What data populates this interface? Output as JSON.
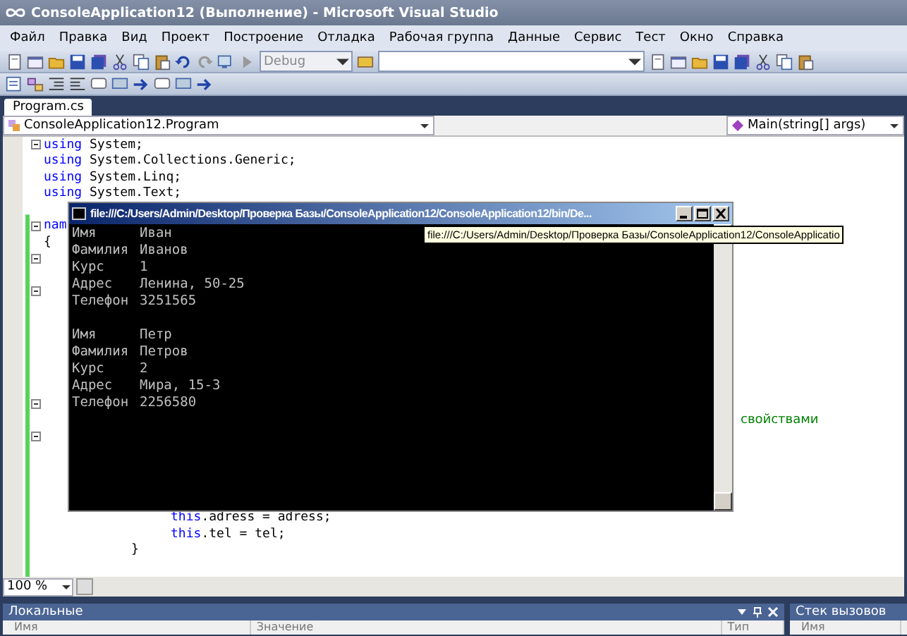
{
  "window": {
    "title": "ConsoleApplication12 (Выполнение) - Microsoft Visual Studio"
  },
  "menu": [
    "Файл",
    "Правка",
    "Вид",
    "Проект",
    "Построение",
    "Отладка",
    "Рабочая группа",
    "Данные",
    "Сервис",
    "Тест",
    "Окно",
    "Справка"
  ],
  "toolbar": {
    "configuration": {
      "value": "Debug",
      "disabled": true
    }
  },
  "document_tabs": [
    {
      "label": "Program.cs",
      "selected": true
    }
  ],
  "nav_bar": {
    "type": "ConsoleApplication12.Program",
    "member": "Main(string[] args)"
  },
  "code_lines": [
    {
      "fold": true,
      "segments": [
        {
          "kind": "keyword",
          "text": "using"
        },
        {
          "kind": "plain",
          "text": " System;"
        }
      ]
    },
    {
      "fold": false,
      "segments": [
        {
          "kind": "keyword",
          "text": "using"
        },
        {
          "kind": "plain",
          "text": " System.Collections.Generic;"
        }
      ]
    },
    {
      "fold": false,
      "segments": [
        {
          "kind": "keyword",
          "text": "using"
        },
        {
          "kind": "plain",
          "text": " System.Linq;"
        }
      ]
    },
    {
      "fold": false,
      "segments": [
        {
          "kind": "keyword",
          "text": "using"
        },
        {
          "kind": "plain",
          "text": " System.Text;"
        }
      ]
    },
    {
      "fold": false
    },
    {
      "fold": true,
      "segments": [
        {
          "kind": "keyword",
          "text": "nam"
        }
      ]
    },
    {
      "fold": false,
      "segments": [
        {
          "kind": "plain",
          "text": "{"
        }
      ]
    },
    {
      "fold": true
    },
    {
      "fold": false
    },
    {
      "fold": true
    },
    {
      "fold": false
    },
    {
      "fold": false
    },
    {
      "fold": false
    },
    {
      "fold": false
    },
    {
      "fold": false
    },
    {
      "fold": false
    },
    {
      "fold": true
    },
    {
      "fold": false,
      "segments": [
        {
          "kind": "comment_tail",
          "text": "свойствами"
        }
      ]
    },
    {
      "fold": true
    },
    {
      "fold": false
    },
    {
      "fold": false
    },
    {
      "fold": false
    },
    {
      "fold": false
    },
    {
      "fold": false,
      "segments": [
        {
          "kind": "indent3"
        },
        {
          "kind": "keyword",
          "text": "this"
        },
        {
          "kind": "plain",
          "text": ".adress = adress;"
        }
      ]
    },
    {
      "fold": false,
      "segments": [
        {
          "kind": "indent3"
        },
        {
          "kind": "keyword",
          "text": "this"
        },
        {
          "kind": "plain",
          "text": ".tel = tel;"
        }
      ]
    },
    {
      "fold": false,
      "segments": [
        {
          "kind": "indent2"
        },
        {
          "kind": "plain",
          "text": "}"
        }
      ]
    }
  ],
  "zoom": {
    "value": "100 %"
  },
  "console": {
    "title": "file:///C:/Users/Admin/Desktop/Проверка Базы/ConsoleApplication12/ConsoleApplication12/bin/De...",
    "records": [
      {
        "fields": [
          {
            "label": "Имя",
            "value": "Иван"
          },
          {
            "label": "Фамилия",
            "value": "Иванов"
          },
          {
            "label": "Курс",
            "value": "1"
          },
          {
            "label": "Адрес",
            "value": "Ленина, 50-25"
          },
          {
            "label": "Телефон",
            "value": "3251565"
          }
        ]
      },
      {
        "fields": [
          {
            "label": "Имя",
            "value": "Петр"
          },
          {
            "label": "Фамилия",
            "value": "Петров"
          },
          {
            "label": "Курс",
            "value": "2"
          },
          {
            "label": "Адрес",
            "value": "Мира, 15-3"
          },
          {
            "label": "Телефон",
            "value": "2256580"
          }
        ]
      }
    ]
  },
  "tooltip": "file:///C:/Users/Admin/Desktop/Проверка Базы/ConsoleApplication12/ConsoleApplicatio",
  "locals_panel": {
    "title": "Локальные",
    "columns": [
      "Имя",
      "Значение",
      "Тип"
    ]
  },
  "call_stack_panel": {
    "title": "Стек вызовов",
    "columns": [
      "Имя"
    ]
  }
}
